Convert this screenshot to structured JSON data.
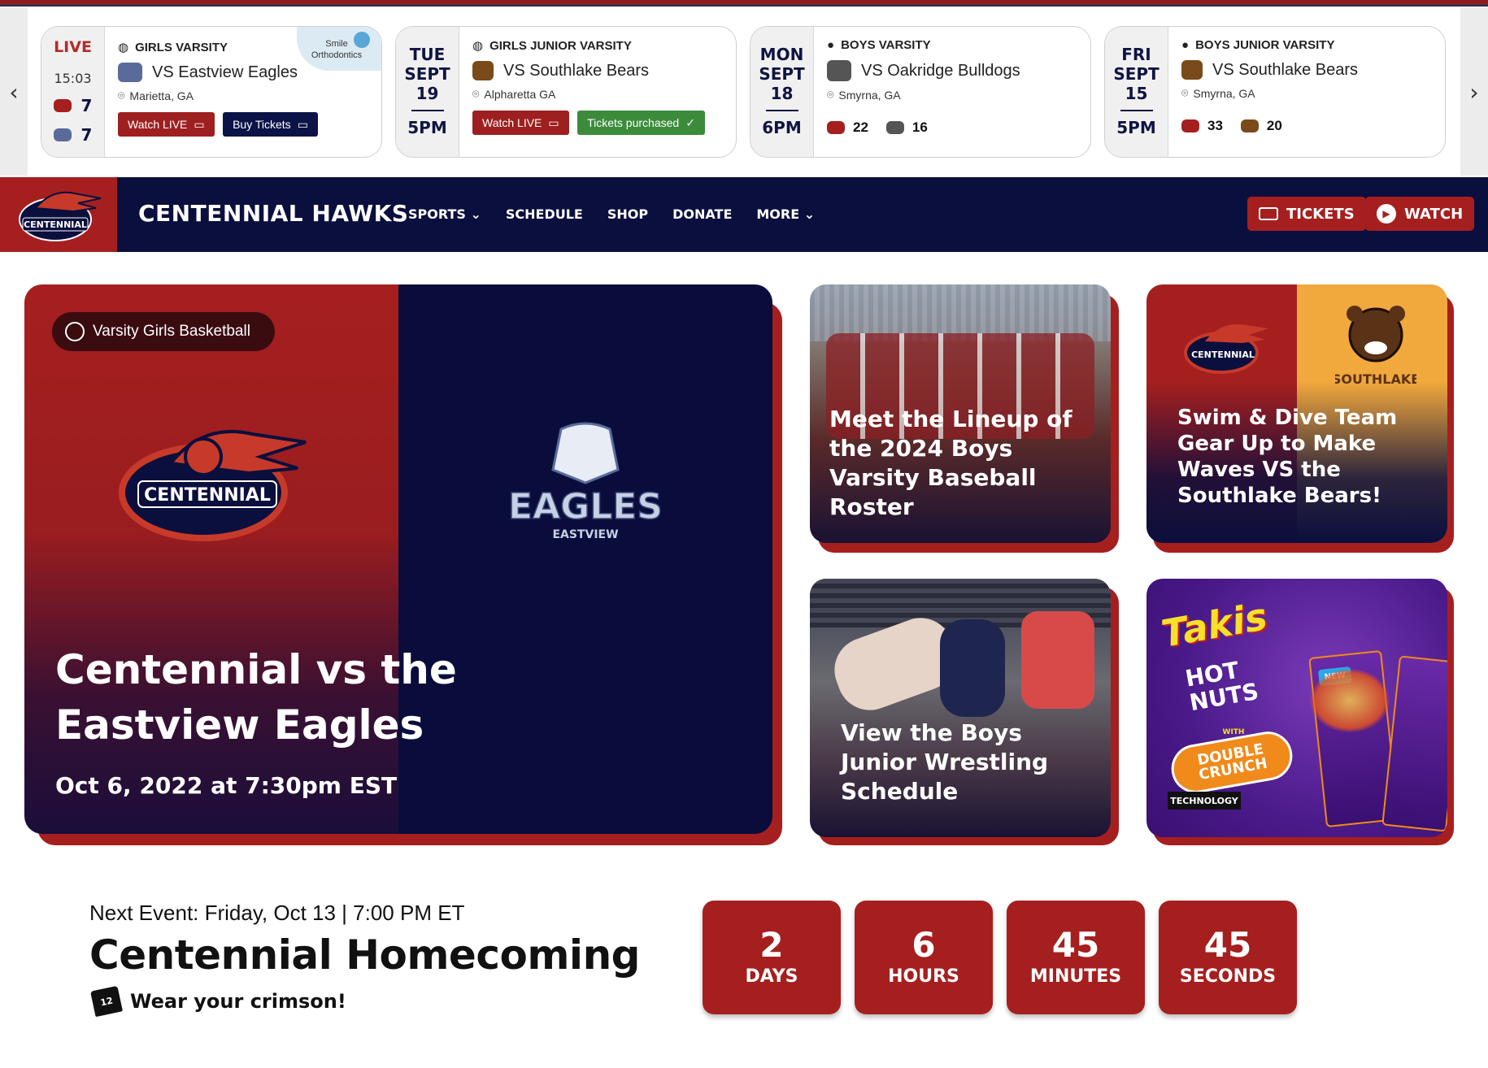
{
  "ticker": {
    "cards": [
      {
        "status": "LIVE",
        "time": "15:03",
        "level": "GIRLS VARSITY",
        "opponent": "VS Eastview Eagles",
        "location": "Marietta, GA",
        "home_score": "7",
        "away_score": "7",
        "btn_watch": "Watch LIVE",
        "btn_tickets": "Buy Tickets",
        "sponsor": "Smile Orthodontics"
      },
      {
        "day": "TUE",
        "month": "SEPT",
        "date": "19",
        "time": "5PM",
        "level": "GIRLS JUNIOR VARSITY",
        "opponent": "VS Southlake Bears",
        "location": "Alpharetta GA",
        "btn_watch": "Watch LIVE",
        "btn_tickets": "Tickets purchased"
      },
      {
        "day": "MON",
        "month": "SEPT",
        "date": "18",
        "time": "6PM",
        "level": "BOYS VARSITY",
        "opponent": "VS Oakridge Bulldogs",
        "location": "Smyrna, GA",
        "home_score": "22",
        "away_score": "16"
      },
      {
        "day": "FRI",
        "month": "SEPT",
        "date": "15",
        "time": "5PM",
        "level": "BOYS JUNIOR VARSITY",
        "opponent": "VS Southlake Bears",
        "location": "Smyrna, GA",
        "home_score": "33",
        "away_score": "20"
      }
    ]
  },
  "nav": {
    "title": "CENTENNIAL HAWKS",
    "logo_text": "CENTENNIAL",
    "items": [
      "SPORTS",
      "SCHEDULE",
      "SHOP",
      "DONATE",
      "MORE"
    ],
    "tickets": "TICKETS",
    "watch": "WATCH"
  },
  "hero": {
    "pill": "Varsity Girls Basketball",
    "home_logo": "CENTENNIAL",
    "away_logo": "EAGLES",
    "away_logo_sub": "EASTVIEW",
    "title": "Centennial vs the Eastview Eagles",
    "date": "Oct 6, 2022 at 7:30pm EST"
  },
  "tiles": [
    {
      "text": "Meet the Lineup of the 2024 Boys Varsity Baseball Roster"
    },
    {
      "text": "Swim & Dive Team Gear Up to Make Waves VS the Southlake Bears!",
      "logo_left": "CENTENNIAL",
      "logo_right": "SOUTHLAKE"
    },
    {
      "text": "View the Boys Junior Wrestling Schedule"
    },
    {
      "brand": "Takis",
      "product": "HOT NUTS",
      "tag": "DOUBLE CRUNCH",
      "sub": "TECHNOLOGY",
      "with": "WITH",
      "new": "NEW"
    }
  ],
  "next_event": {
    "label": "Next Event: Friday, Oct 13 | 7:00 PM ET",
    "title": "Centennial Homecoming",
    "note": "Wear your crimson!",
    "jersey_number": "12"
  },
  "countdown": [
    {
      "value": "2",
      "unit": "DAYS"
    },
    {
      "value": "6",
      "unit": "HOURS"
    },
    {
      "value": "45",
      "unit": "MINUTES"
    },
    {
      "value": "45",
      "unit": "SECONDS"
    }
  ],
  "colors": {
    "crimson": "#a61f1f",
    "navy": "#0b0f3d",
    "success": "#3b8b3b"
  }
}
